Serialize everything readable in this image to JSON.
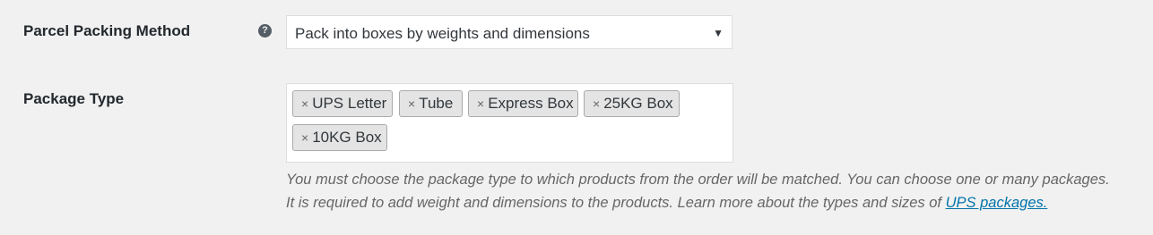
{
  "packing_method": {
    "label": "Parcel Packing Method",
    "help_icon": "question-circle-icon",
    "selected_value": "Pack into boxes by weights and dimensions",
    "arrow": "▼"
  },
  "package_type": {
    "label": "Package Type",
    "remove_symbol": "×",
    "tags": [
      {
        "label": "UPS Letter"
      },
      {
        "label": "Tube"
      },
      {
        "label": "Express Box"
      },
      {
        "label": "25KG Box"
      },
      {
        "label": "10KG Box"
      }
    ],
    "description_line1": "You must choose the package type to which products from the order will be matched. You can choose one or many packages.",
    "description_line2": "It is required to add weight and dimensions to the products. Learn more about the types and sizes of ",
    "description_link": "UPS packages."
  },
  "colors": {
    "background": "#f1f1f1",
    "link": "#0073aa",
    "tag_background": "#e4e4e4",
    "tag_border": "#aaaaaa"
  }
}
